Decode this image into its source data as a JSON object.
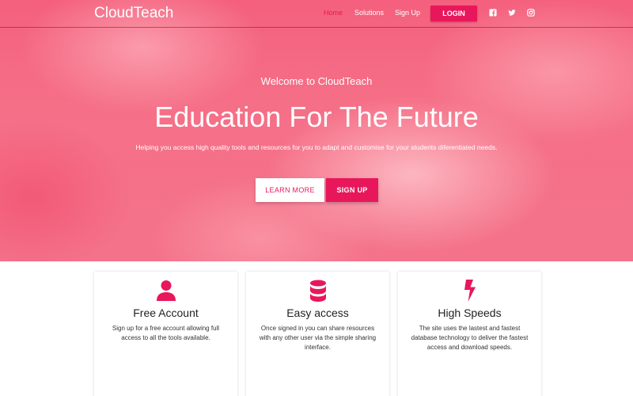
{
  "colors": {
    "accent": "#e8175b",
    "hero_pink": "#f56f87"
  },
  "nav": {
    "brand": "CloudTeach",
    "links": [
      "Home",
      "Solutions",
      "Sign Up"
    ],
    "login": "LOGIN",
    "social_icons": [
      "facebook-icon",
      "twitter-icon",
      "instagram-icon"
    ]
  },
  "hero": {
    "welcome": "Welcome to CloudTeach",
    "headline": "Education For The Future",
    "subtitle": "Helping you access high quality tools and resources for you to adapt and customise for your students diferentiated needs.",
    "learn_more": "LEARN MORE",
    "sign_up": "SIGN UP"
  },
  "features": [
    {
      "icon": "user-icon",
      "title": "Free Account",
      "text": "Sign up for a free account allowing full access to all the tools available."
    },
    {
      "icon": "database-icon",
      "title": "Easy access",
      "text": "Once signed in you can share resources with any other user via the simple sharing interface."
    },
    {
      "icon": "bolt-icon",
      "title": "High Speeds",
      "text": "The site uses the lastest and fastest database technology to deliver the fastest access and download speeds."
    }
  ]
}
